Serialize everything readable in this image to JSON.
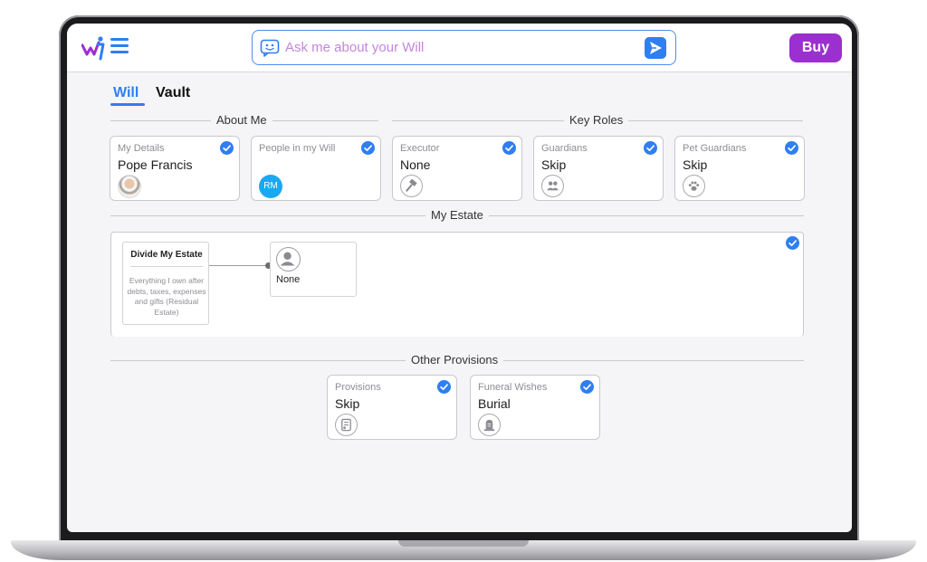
{
  "app": {
    "brand_color": "#9b2fcf",
    "accent_color": "#2f7ef2"
  },
  "header": {
    "search_placeholder": "Ask me about your Will",
    "buy_label": "Buy"
  },
  "tabs": [
    {
      "label": "Will",
      "active": true
    },
    {
      "label": "Vault",
      "active": false
    }
  ],
  "sections": {
    "about_me": "About Me",
    "key_roles": "Key Roles",
    "my_estate": "My Estate",
    "other_provisions": "Other Provisions"
  },
  "about_me_cards": [
    {
      "title": "My Details",
      "value": "Pope Francis",
      "icon": "profile-photo",
      "completed": true
    },
    {
      "title": "People in my Will",
      "value": "",
      "avatar_initials": "RM",
      "completed": true
    }
  ],
  "key_role_cards": [
    {
      "title": "Executor",
      "value": "None",
      "icon": "gavel-icon",
      "completed": true
    },
    {
      "title": "Guardians",
      "value": "Skip",
      "icon": "people-icon",
      "completed": true
    },
    {
      "title": "Pet Guardians",
      "value": "Skip",
      "icon": "paw-icon",
      "completed": true
    }
  ],
  "estate": {
    "completed": true,
    "divide_title": "Divide My Estate",
    "divide_description": "Everything I own after debts, taxes, expenses and gifts (Residual Estate)",
    "beneficiary": {
      "name": "None",
      "icon": "person-icon"
    }
  },
  "provision_cards": [
    {
      "title": "Provisions",
      "value": "Skip",
      "icon": "document-icon",
      "completed": true
    },
    {
      "title": "Funeral Wishes",
      "value": "Burial",
      "icon": "tombstone-icon",
      "completed": true
    }
  ]
}
